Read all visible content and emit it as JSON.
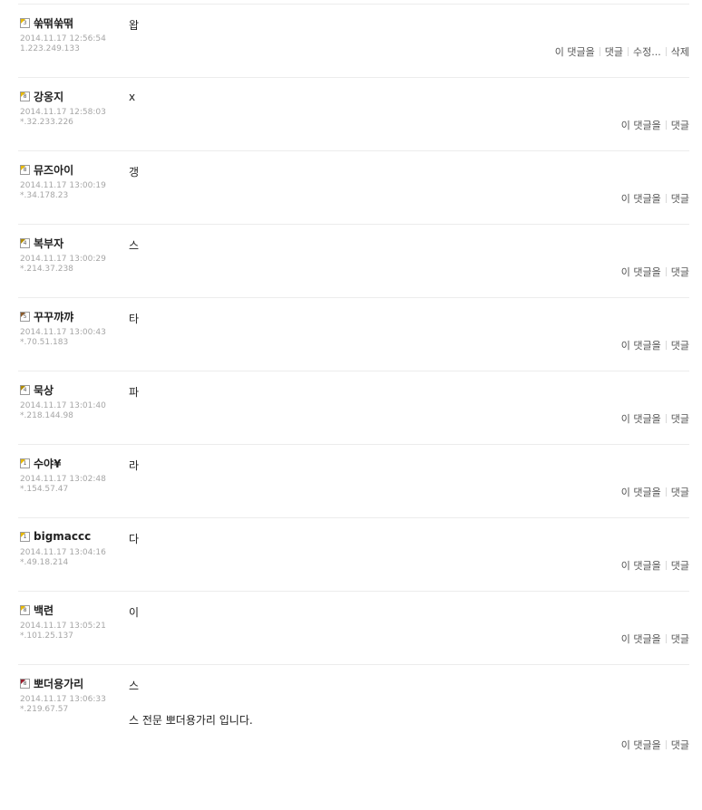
{
  "actions_labels": {
    "reply_to": "이 댓글을",
    "reply": "댓글",
    "edit": "수정...",
    "delete": "삭제"
  },
  "comments": [
    {
      "level": "3",
      "level_color": "#e7b800",
      "nickname": "쑦떢쑦떢",
      "datetime": "2014.11.17 12:56:54",
      "ip": "1.223.249.133",
      "text": "왑",
      "editable": true
    },
    {
      "level": "8",
      "level_color": "#e7b800",
      "nickname": "강옹지",
      "datetime": "2014.11.17 12:58:03",
      "ip": "*.32.233.226",
      "text": "x"
    },
    {
      "level": "8",
      "level_color": "#e7b800",
      "nickname": "뮤즈아이",
      "datetime": "2014.11.17 13:00:19",
      "ip": "*.34.178.23",
      "text": "갱"
    },
    {
      "level": "4",
      "level_color": "#b08a00",
      "nickname": "복부자",
      "datetime": "2014.11.17 13:00:29",
      "ip": "*.214.37.238",
      "text": "스"
    },
    {
      "level": "5",
      "level_color": "#8a5a2b",
      "nickname": "꾸꾸꺄꺄",
      "datetime": "2014.11.17 13:00:43",
      "ip": "*.70.51.183",
      "text": "타"
    },
    {
      "level": "4",
      "level_color": "#b08a00",
      "nickname": "묵상",
      "datetime": "2014.11.17 13:01:40",
      "ip": "*.218.144.98",
      "text": "파"
    },
    {
      "level": "1",
      "level_color": "#e7b800",
      "nickname": "수야¥",
      "datetime": "2014.11.17 13:02:48",
      "ip": "*.154.57.47",
      "text": "라"
    },
    {
      "level": "1",
      "level_color": "#e7b800",
      "nickname": "bigmaccc",
      "datetime": "2014.11.17 13:04:16",
      "ip": "*.49.18.214",
      "text": "다"
    },
    {
      "level": "8",
      "level_color": "#e7b800",
      "nickname": "백련",
      "datetime": "2014.11.17 13:05:21",
      "ip": "*.101.25.137",
      "text": "이"
    },
    {
      "level": "8",
      "level_color": "#9b1c2c",
      "nickname": "뽀더용가리",
      "datetime": "2014.11.17 13:06:33",
      "ip": "*.219.67.57",
      "text": "스",
      "text_extra": "스 전문 뽀더용가리 입니다."
    }
  ]
}
